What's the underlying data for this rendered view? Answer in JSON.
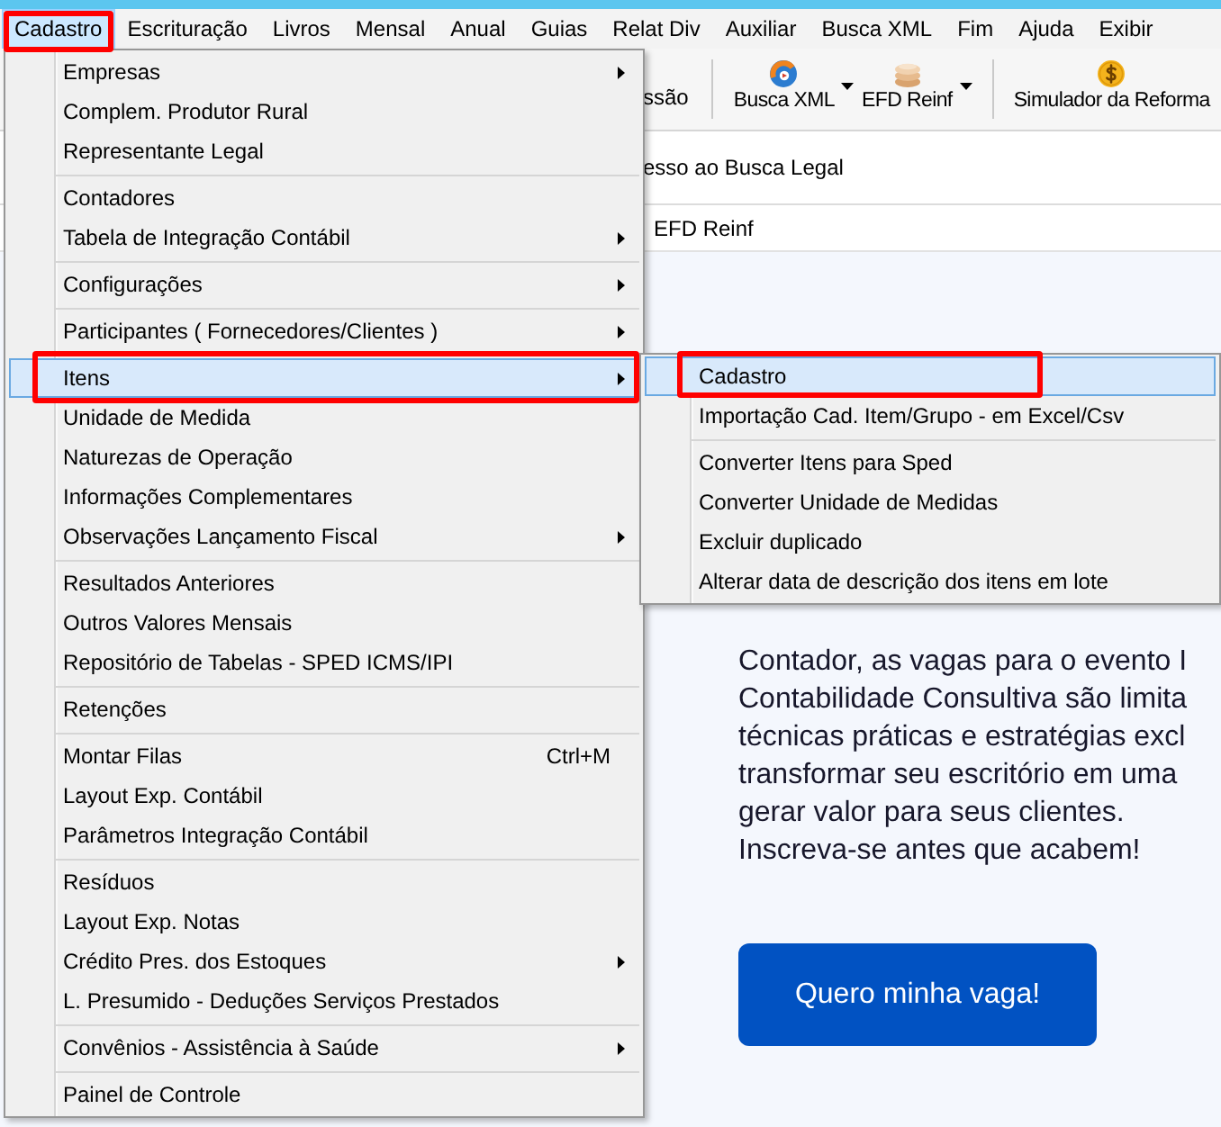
{
  "menu_bar": {
    "items": [
      {
        "label": "Cadastro",
        "selected": true,
        "marked": true
      },
      {
        "label": "Escrituração",
        "selected": false,
        "marked": false
      },
      {
        "label": "Livros",
        "selected": false,
        "marked": false
      },
      {
        "label": "Mensal",
        "selected": false,
        "marked": false
      },
      {
        "label": "Anual",
        "selected": false,
        "marked": false
      },
      {
        "label": "Guias",
        "selected": false,
        "marked": false
      },
      {
        "label": "Relat Div",
        "selected": false,
        "marked": false
      },
      {
        "label": "Auxiliar",
        "selected": false,
        "marked": false
      },
      {
        "label": "Busca XML",
        "selected": false,
        "marked": false
      },
      {
        "label": "Fim",
        "selected": false,
        "marked": false
      },
      {
        "label": "Ajuda",
        "selected": false,
        "marked": false
      },
      {
        "label": "Exibir",
        "selected": false,
        "marked": false
      }
    ]
  },
  "toolbar": {
    "items": [
      {
        "kind": "text-button",
        "label": "ssão"
      },
      {
        "kind": "separator"
      },
      {
        "kind": "button",
        "label": "Busca XML",
        "dropdown": true
      },
      {
        "kind": "button",
        "label": "EFD Reinf",
        "dropdown": true
      },
      {
        "kind": "separator"
      },
      {
        "kind": "button",
        "label": "Simulador da Reforma",
        "dropdown": false
      }
    ]
  },
  "banner": {
    "link": "esso ao Busca Legal"
  },
  "section": {
    "label": "EFD Reinf"
  },
  "menu": {
    "items": [
      {
        "kind": "item",
        "label": "Empresas",
        "submenu": true,
        "selected": false,
        "marked": false
      },
      {
        "kind": "item",
        "label": "Complem. Produtor Rural",
        "submenu": false,
        "selected": false,
        "marked": false
      },
      {
        "kind": "item",
        "label": "Representante Legal",
        "submenu": false,
        "selected": false,
        "marked": false
      },
      {
        "kind": "separator"
      },
      {
        "kind": "item",
        "label": "Contadores",
        "submenu": false,
        "selected": false,
        "marked": false
      },
      {
        "kind": "item",
        "label": "Tabela de Integração Contábil",
        "submenu": true,
        "selected": false,
        "marked": false
      },
      {
        "kind": "separator"
      },
      {
        "kind": "item",
        "label": "Configurações",
        "submenu": true,
        "selected": false,
        "marked": false
      },
      {
        "kind": "separator"
      },
      {
        "kind": "item",
        "label": "Participantes ( Fornecedores/Clientes )",
        "submenu": true,
        "selected": false,
        "marked": false
      },
      {
        "kind": "separator"
      },
      {
        "kind": "item",
        "label": "Itens",
        "submenu": true,
        "selected": true,
        "marked": true
      },
      {
        "kind": "item",
        "label": "Unidade de Medida",
        "submenu": false,
        "selected": false,
        "marked": false
      },
      {
        "kind": "item",
        "label": "Naturezas de Operação",
        "submenu": false,
        "selected": false,
        "marked": false
      },
      {
        "kind": "item",
        "label": "Informações Complementares",
        "submenu": false,
        "selected": false,
        "marked": false
      },
      {
        "kind": "item",
        "label": "Observações Lançamento Fiscal",
        "submenu": true,
        "selected": false,
        "marked": false
      },
      {
        "kind": "separator"
      },
      {
        "kind": "item",
        "label": "Resultados Anteriores",
        "submenu": false,
        "selected": false,
        "marked": false
      },
      {
        "kind": "item",
        "label": "Outros Valores Mensais",
        "submenu": false,
        "selected": false,
        "marked": false
      },
      {
        "kind": "item",
        "label": "Repositório de Tabelas - SPED ICMS/IPI",
        "submenu": false,
        "selected": false,
        "marked": false
      },
      {
        "kind": "separator"
      },
      {
        "kind": "item",
        "label": "Retenções",
        "submenu": false,
        "selected": false,
        "marked": false
      },
      {
        "kind": "separator"
      },
      {
        "kind": "item",
        "label": "Montar Filas",
        "shortcut": "Ctrl+M",
        "submenu": false,
        "selected": false,
        "marked": false
      },
      {
        "kind": "item",
        "label": "Layout Exp. Contábil",
        "submenu": false,
        "selected": false,
        "marked": false
      },
      {
        "kind": "item",
        "label": "Parâmetros Integração Contábil",
        "submenu": false,
        "selected": false,
        "marked": false
      },
      {
        "kind": "separator"
      },
      {
        "kind": "item",
        "label": "Resíduos",
        "submenu": false,
        "selected": false,
        "marked": false
      },
      {
        "kind": "item",
        "label": "Layout Exp. Notas",
        "submenu": false,
        "selected": false,
        "marked": false
      },
      {
        "kind": "item",
        "label": "Crédito Pres. dos Estoques",
        "submenu": true,
        "selected": false,
        "marked": false
      },
      {
        "kind": "item",
        "label": "L. Presumido - Deduções Serviços Prestados",
        "submenu": false,
        "selected": false,
        "marked": false
      },
      {
        "kind": "separator"
      },
      {
        "kind": "item",
        "label": "Convênios - Assistência à Saúde",
        "submenu": true,
        "selected": false,
        "marked": false
      },
      {
        "kind": "separator"
      },
      {
        "kind": "item",
        "label": "Painel de Controle",
        "submenu": false,
        "selected": false,
        "marked": false
      }
    ]
  },
  "submenu": {
    "items": [
      {
        "kind": "item",
        "label": "Cadastro",
        "submenu": false,
        "selected": true,
        "marked": true
      },
      {
        "kind": "item",
        "label": "Importação Cad. Item/Grupo - em Excel/Csv",
        "submenu": false,
        "selected": false,
        "marked": false
      },
      {
        "kind": "separator"
      },
      {
        "kind": "item",
        "label": "Converter Itens para Sped",
        "submenu": false,
        "selected": false,
        "marked": false
      },
      {
        "kind": "item",
        "label": "Converter Unidade de Medidas",
        "submenu": false,
        "selected": false,
        "marked": false
      },
      {
        "kind": "item",
        "label": "Excluir duplicado",
        "submenu": false,
        "selected": false,
        "marked": false
      },
      {
        "kind": "item",
        "label": "Alterar data de descrição dos itens em lote",
        "submenu": false,
        "selected": false,
        "marked": false
      }
    ]
  },
  "promo": {
    "lines": [
      "Contador, as vagas para o evento I",
      "Contabilidade Consultiva são limita",
      "técnicas práticas e estratégias excl",
      "transformar seu escritório em uma",
      "gerar valor para seus clientes.",
      "Inscreva-se antes que acabem!"
    ],
    "button": "Quero minha vaga!"
  }
}
